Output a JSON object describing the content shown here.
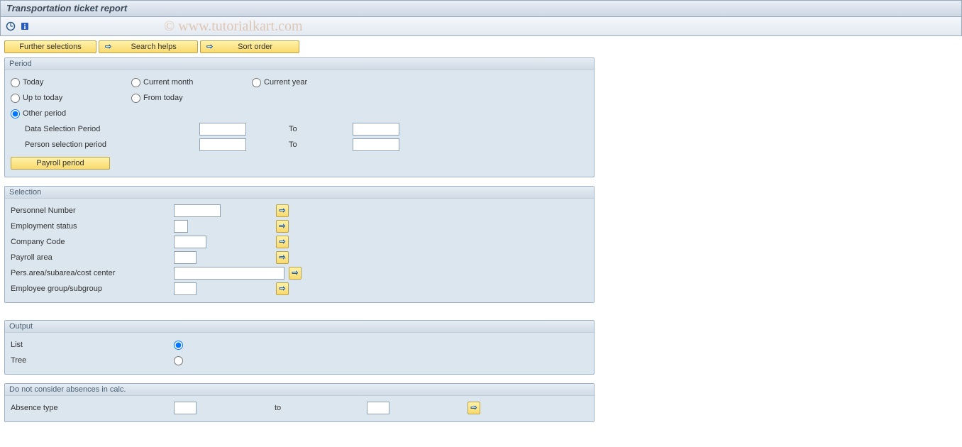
{
  "title": "Transportation ticket report",
  "watermark": "© www.tutorialkart.com",
  "toolbar_buttons": {
    "further_selections": "Further selections",
    "search_helps": "Search helps",
    "sort_order": "Sort order"
  },
  "period": {
    "title": "Period",
    "options": {
      "today": "Today",
      "up_to_today": "Up to today",
      "other_period": "Other period",
      "current_month": "Current month",
      "from_today": "From today",
      "current_year": "Current year"
    },
    "selected": "other_period",
    "data_selection_label": "Data Selection Period",
    "person_selection_label": "Person selection period",
    "to_label": "To",
    "data_from": "",
    "data_to": "",
    "person_from": "",
    "person_to": "",
    "payroll_button": "Payroll period"
  },
  "selection": {
    "title": "Selection",
    "fields": {
      "personnel_number": {
        "label": "Personnel Number",
        "value": ""
      },
      "employment_status": {
        "label": "Employment status",
        "value": ""
      },
      "company_code": {
        "label": "Company Code",
        "value": ""
      },
      "payroll_area": {
        "label": "Payroll area",
        "value": ""
      },
      "pers_area": {
        "label": "Pers.area/subarea/cost center",
        "value": ""
      },
      "employee_group": {
        "label": "Employee group/subgroup",
        "value": ""
      }
    }
  },
  "output": {
    "title": "Output",
    "list": "List",
    "tree": "Tree",
    "selected": "list"
  },
  "absences": {
    "title": "Do not consider absences in calc.",
    "absence_type": "Absence type",
    "to": "to",
    "from_value": "",
    "to_value": ""
  }
}
